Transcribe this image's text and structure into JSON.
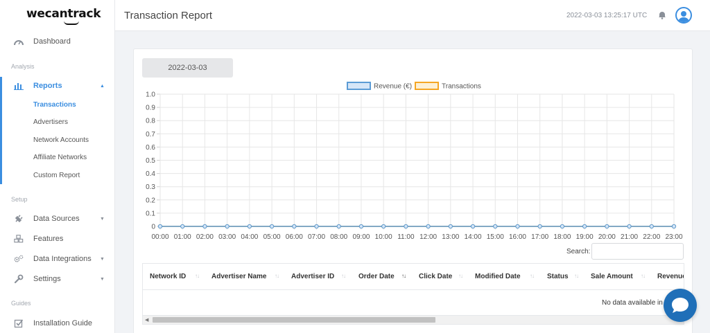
{
  "app": {
    "logo_text": "wecantrack"
  },
  "sidebar": {
    "items": [
      {
        "label": "Dashboard",
        "icon": "speedometer-icon"
      }
    ],
    "sections": {
      "analysis": "Analysis",
      "setup": "Setup",
      "guides": "Guides"
    },
    "reports": {
      "label": "Reports",
      "icon": "bar-chart-icon",
      "subitems": [
        "Transactions",
        "Advertisers",
        "Network Accounts",
        "Affiliate Networks",
        "Custom Report"
      ]
    },
    "setup_items": [
      {
        "label": "Data Sources",
        "icon": "plug-icon"
      },
      {
        "label": "Features",
        "icon": "cubes-icon"
      },
      {
        "label": "Data Integrations",
        "icon": "cogs-icon"
      },
      {
        "label": "Settings",
        "icon": "wrench-icon"
      }
    ],
    "guide_items": [
      {
        "label": "Installation Guide",
        "icon": "checkbox-icon"
      }
    ]
  },
  "header": {
    "title": "Transaction Report",
    "timestamp": "2022-03-03 13:25:17 UTC"
  },
  "filters": {
    "date": "2022-03-03"
  },
  "chart_data": {
    "type": "line",
    "x": [
      "00:00",
      "01:00",
      "02:00",
      "03:00",
      "04:00",
      "05:00",
      "06:00",
      "07:00",
      "08:00",
      "09:00",
      "10:00",
      "11:00",
      "12:00",
      "13:00",
      "14:00",
      "15:00",
      "16:00",
      "17:00",
      "18:00",
      "19:00",
      "20:00",
      "21:00",
      "22:00",
      "23:00"
    ],
    "series": [
      {
        "name": "Revenue (€)",
        "color": "#5b9bd5",
        "fill": "#d6e6f7",
        "values": [
          0,
          0,
          0,
          0,
          0,
          0,
          0,
          0,
          0,
          0,
          0,
          0,
          0,
          0,
          0,
          0,
          0,
          0,
          0,
          0,
          0,
          0,
          0,
          0
        ]
      },
      {
        "name": "Transactions",
        "color": "#f5a623",
        "fill": "#fdf0d5",
        "values": [
          0,
          0,
          0,
          0,
          0,
          0,
          0,
          0,
          0,
          0,
          0,
          0,
          0,
          0,
          0,
          0,
          0,
          0,
          0,
          0,
          0,
          0,
          0,
          0
        ]
      }
    ],
    "yticks": [
      "1.0",
      "0.9",
      "0.8",
      "0.7",
      "0.6",
      "0.5",
      "0.4",
      "0.3",
      "0.2",
      "0.1",
      "0"
    ],
    "ylim": [
      0,
      1
    ],
    "grid": true,
    "legend": "top-center"
  },
  "table": {
    "search_label": "Search:",
    "search_value": "",
    "columns": [
      "Network ID",
      "Advertiser Name",
      "Advertiser ID",
      "Order Date",
      "Click Date",
      "Modified Date",
      "Status",
      "Sale Amount",
      "Revenue"
    ],
    "sorted_column": "Order Date",
    "empty_message": "No data available in table"
  }
}
